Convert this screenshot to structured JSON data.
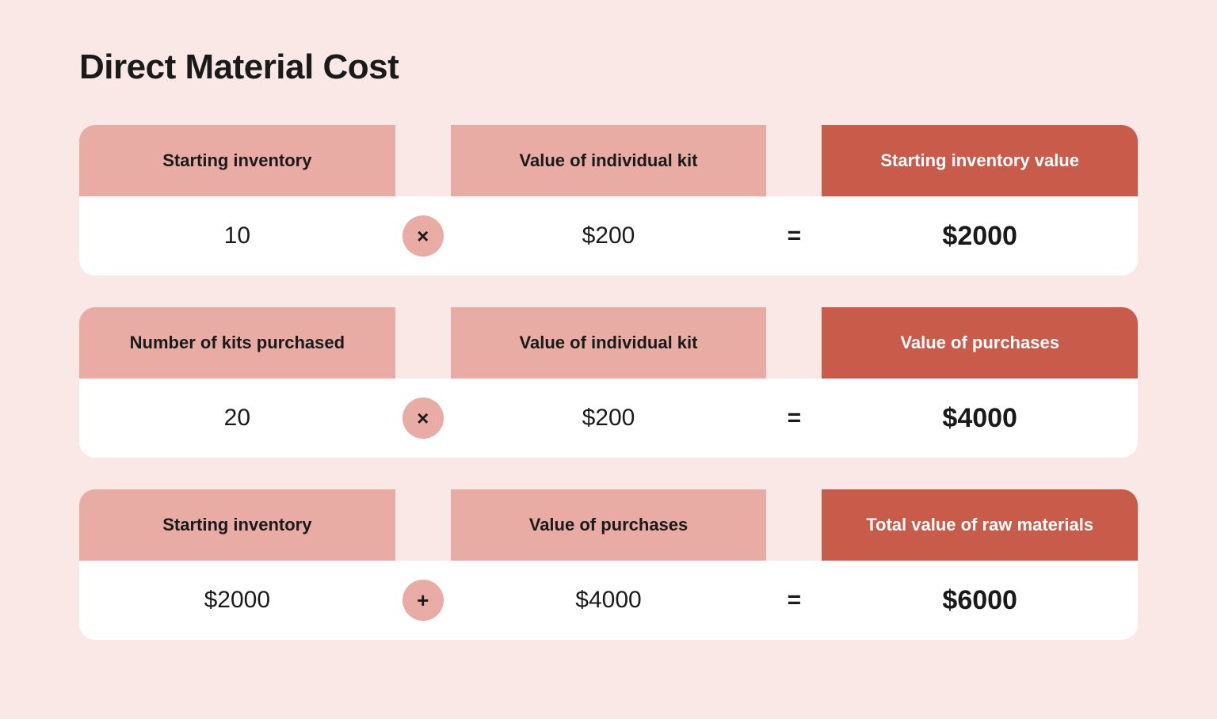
{
  "page": {
    "title": "Direct Material Cost",
    "bg_color": "#f9e8e6"
  },
  "block1": {
    "label1": "Starting inventory",
    "label2": "Value of individual kit",
    "label3": "Starting inventory value",
    "operator": "×",
    "val1": "10",
    "val2": "$200",
    "val3": "$2000"
  },
  "block2": {
    "label1": "Number of kits purchased",
    "label2": "Value of individual kit",
    "label3": "Value of purchases",
    "operator": "×",
    "val1": "20",
    "val2": "$200",
    "val3": "$4000"
  },
  "block3": {
    "label1": "Starting inventory",
    "label2": "Value of purchases",
    "label3": "Total value of raw materials",
    "operator": "+",
    "val1": "$2000",
    "val2": "$4000",
    "val3": "$6000"
  },
  "equals_symbol": "="
}
